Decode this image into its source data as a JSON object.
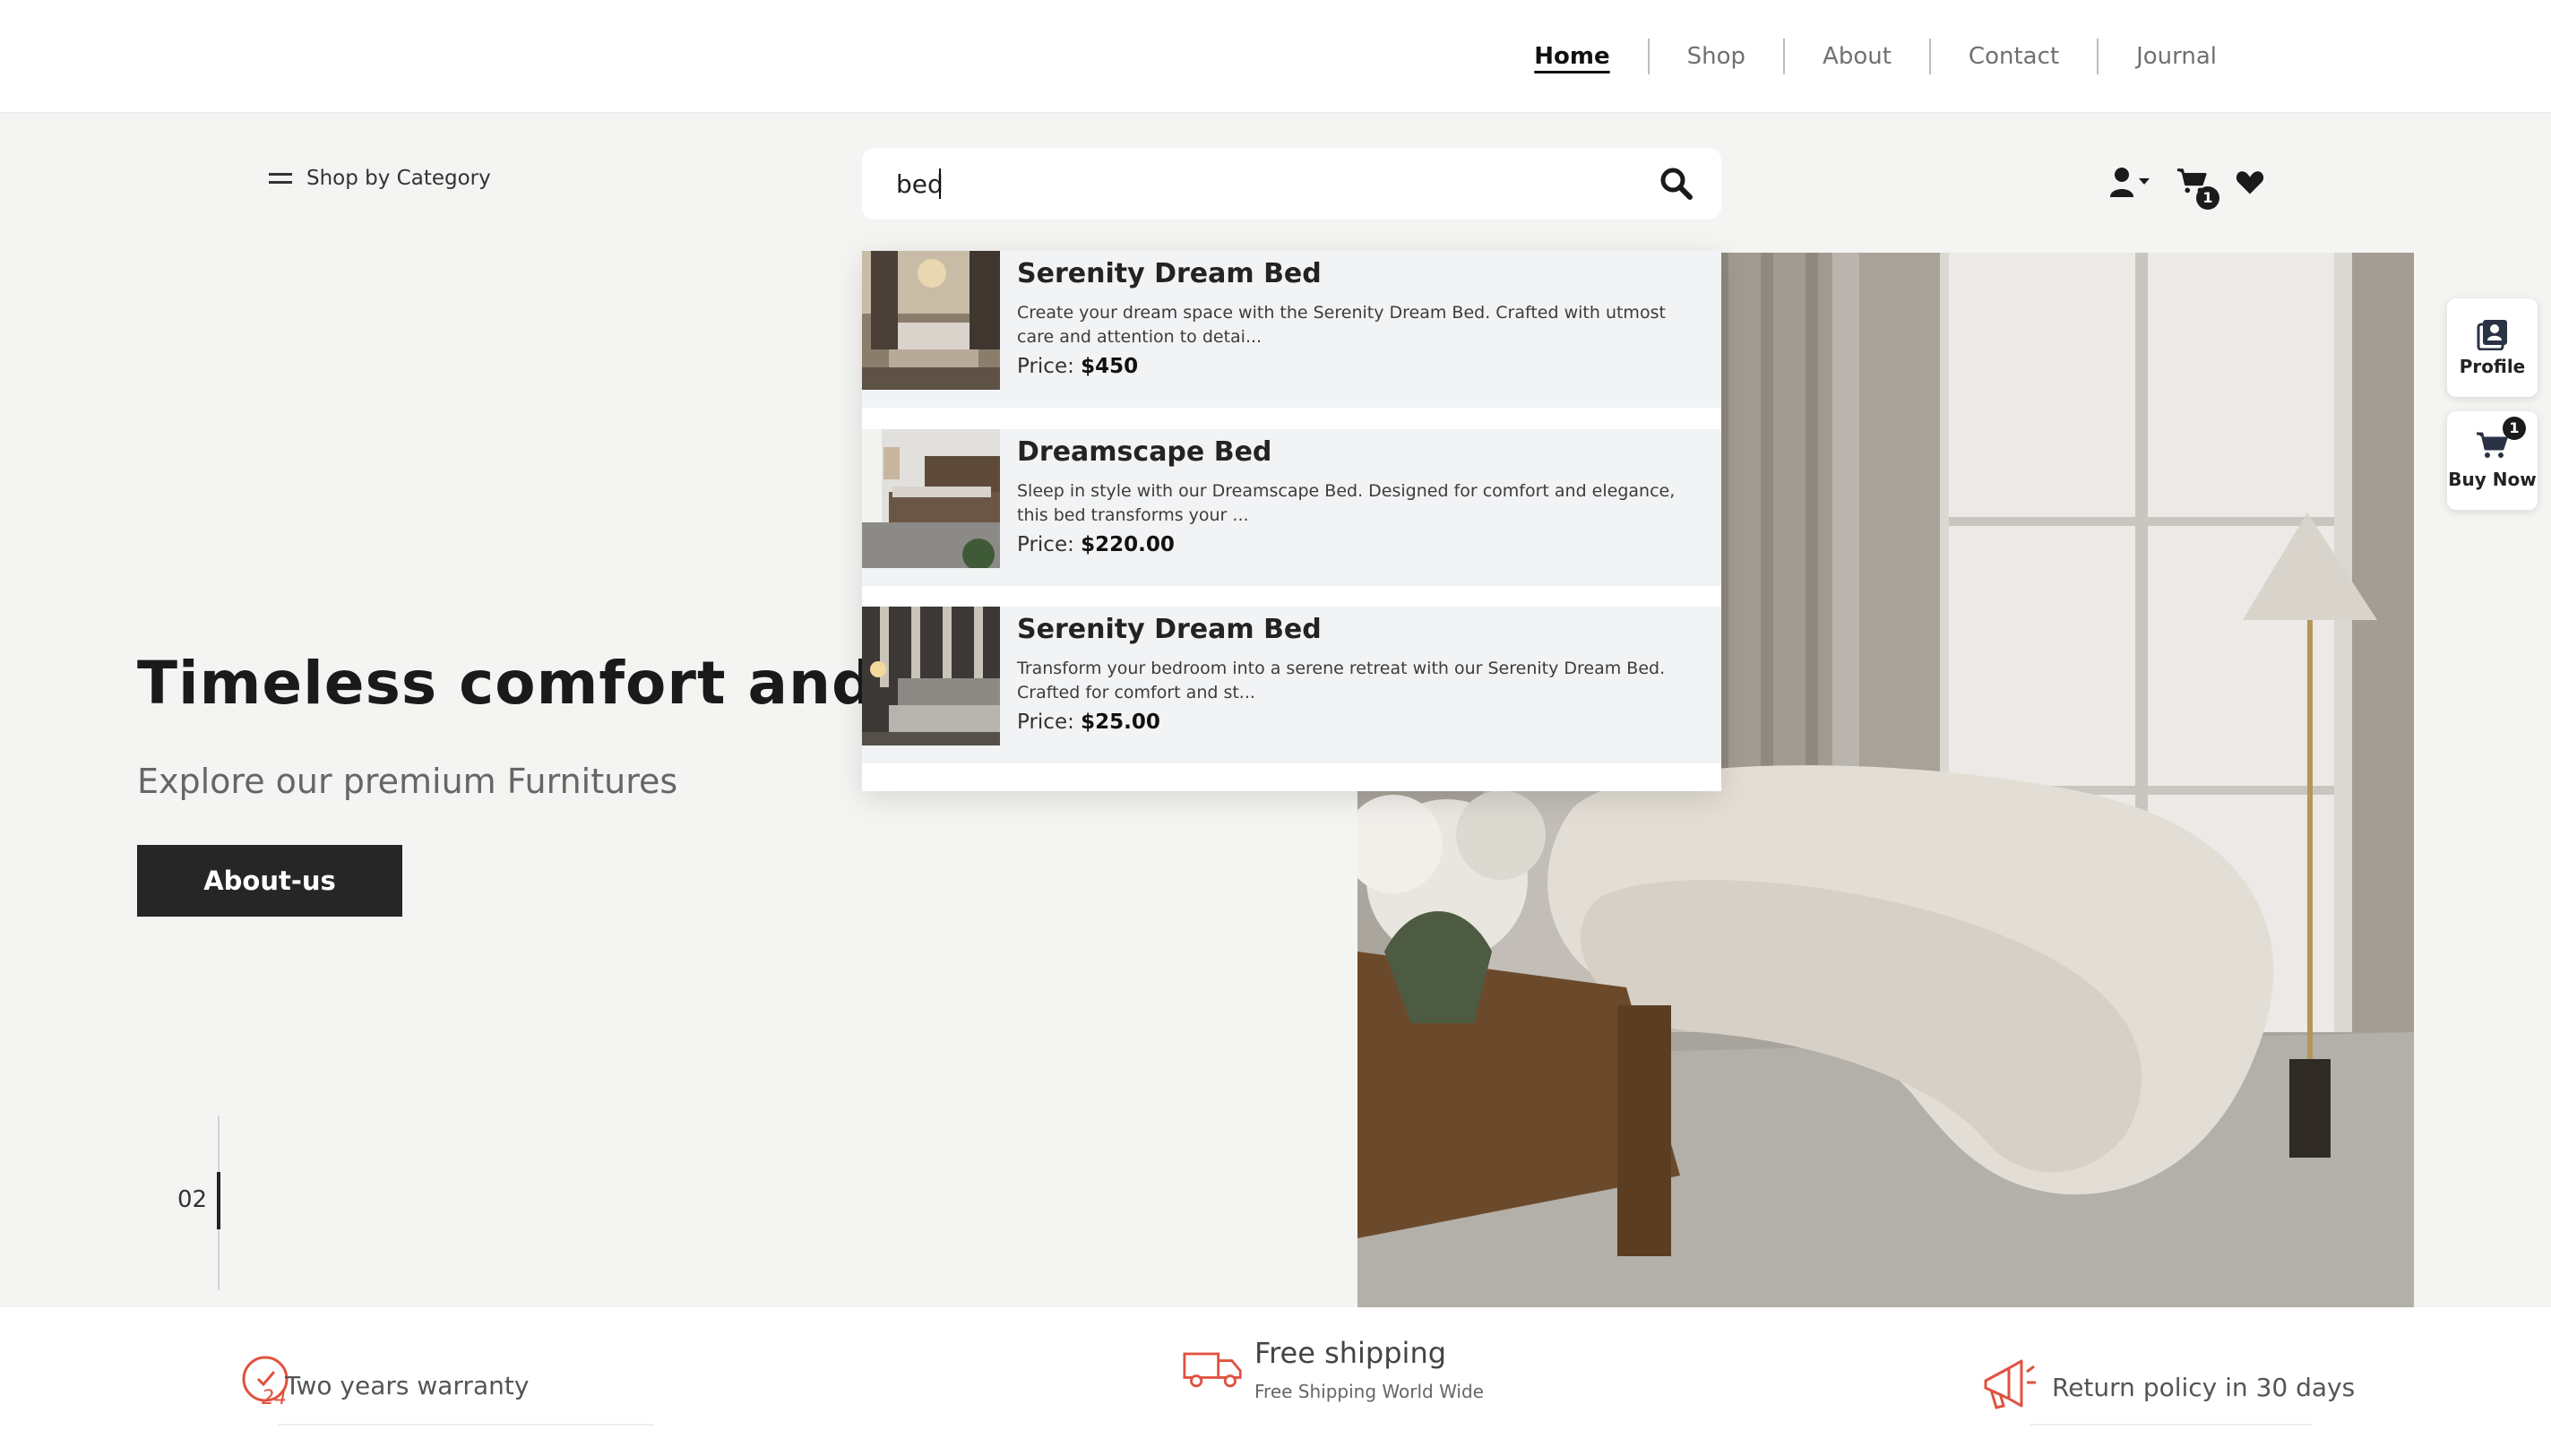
{
  "nav": {
    "items": [
      {
        "label": "Home",
        "active": true
      },
      {
        "label": "Shop"
      },
      {
        "label": "About"
      },
      {
        "label": "Contact"
      },
      {
        "label": "Journal"
      }
    ]
  },
  "header": {
    "category_label": "Shop by Category",
    "search_value": "bed",
    "cart_count": "1"
  },
  "hero": {
    "title": "Timeless comfort and styl",
    "subtitle": "Explore our premium Furnitures",
    "button_label": "About-us",
    "slide_number": "02"
  },
  "search_results": [
    {
      "name": "Serenity Dream Bed",
      "description": "Create your dream space with the Serenity Dream Bed. Crafted with utmost care and attention to detai...",
      "price_label": "Price: ",
      "price": "$450"
    },
    {
      "name": "Dreamscape Bed",
      "description": "Sleep in style with our Dreamscape Bed. Designed for comfort and elegance, this bed transforms your ...",
      "price_label": "Price: ",
      "price": "$220.00"
    },
    {
      "name": "Serenity Dream Bed",
      "description": "Transform your bedroom into a serene retreat with our Serenity Dream Bed. Crafted for comfort and st...",
      "price_label": "Price: ",
      "price": "$25.00"
    }
  ],
  "side_widgets": {
    "profile_label": "Profile",
    "buy_label": "Buy Now",
    "buy_count": "1"
  },
  "features": {
    "warranty": "Two years warranty",
    "shipping_title": "Free shipping",
    "shipping_sub": "Free Shipping World Wide",
    "returns": "Return policy in 30 days"
  },
  "colors": {
    "accent": "#e0523f",
    "dark": "#262626",
    "background": "#f4f4f2"
  }
}
